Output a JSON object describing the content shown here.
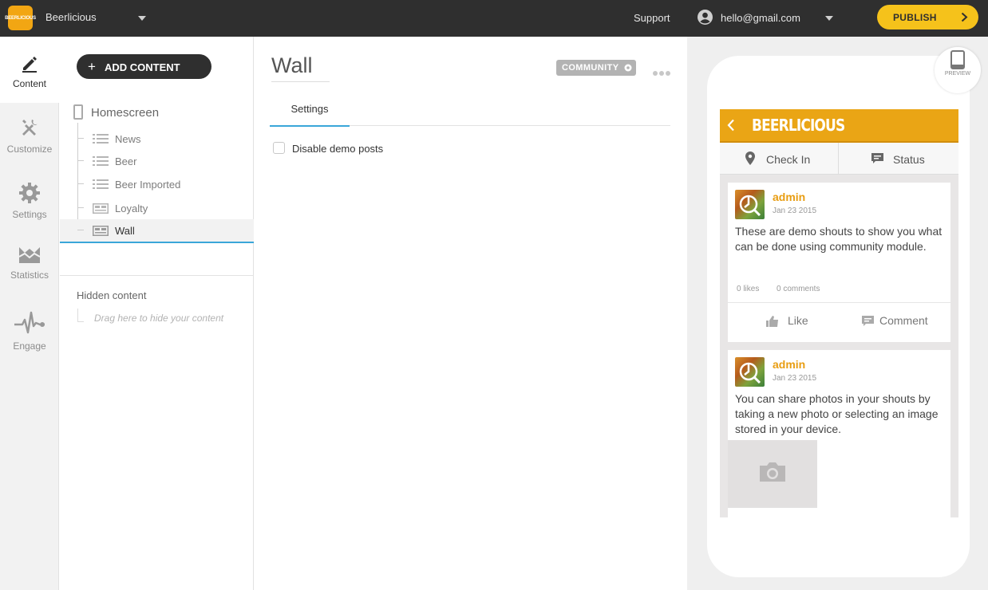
{
  "topbar": {
    "logo_text": "BEERLICIOUS",
    "app_name": "Beerlicious",
    "support": "Support",
    "user_email": "hello@gmail.com",
    "publish": "PUBLISH"
  },
  "leftnav": [
    {
      "label": "Content",
      "icon": "pen-icon",
      "active": true
    },
    {
      "label": "Customize",
      "icon": "tools-icon",
      "active": false
    },
    {
      "label": "Settings",
      "icon": "gear-icon",
      "active": false
    },
    {
      "label": "Statistics",
      "icon": "chart-icon",
      "active": false
    },
    {
      "label": "Engage",
      "icon": "pulse-icon",
      "active": false
    }
  ],
  "content_panel": {
    "add_button": "ADD CONTENT",
    "root": "Homescreen",
    "items": [
      {
        "label": "News",
        "icon": "list-icon"
      },
      {
        "label": "Beer",
        "icon": "list-icon"
      },
      {
        "label": "Beer Imported",
        "icon": "list-icon"
      },
      {
        "label": "Loyalty",
        "icon": "card-icon"
      },
      {
        "label": "Wall",
        "icon": "card-icon",
        "selected": true
      }
    ],
    "hidden_title": "Hidden content",
    "hidden_hint": "Drag here to hide your content"
  },
  "editor": {
    "title": "Wall",
    "badge": "COMMUNITY",
    "tab": "Settings",
    "checkbox_label": "Disable demo posts",
    "checkbox_checked": false
  },
  "preview": {
    "preview_label": "PREVIEW",
    "app_title": "BEERLICIOUS",
    "check_in": "Check In",
    "status": "Status",
    "posts": [
      {
        "author": "admin",
        "date": "Jan 23 2015",
        "text": "These are demo shouts to show you what can be done using community module.",
        "likes": "0 likes",
        "comments": "0 comments",
        "like_label": "Like",
        "comment_label": "Comment"
      },
      {
        "author": "admin",
        "date": "Jan 23 2015",
        "text": "You can share photos in your shouts by taking a new photo or selecting an image stored in your device."
      }
    ]
  },
  "colors": {
    "topbar": "#2f2f2f",
    "accent_yellow": "#f5c21b",
    "app_orange": "#eaa515",
    "selection_blue": "#3aa6d9"
  }
}
